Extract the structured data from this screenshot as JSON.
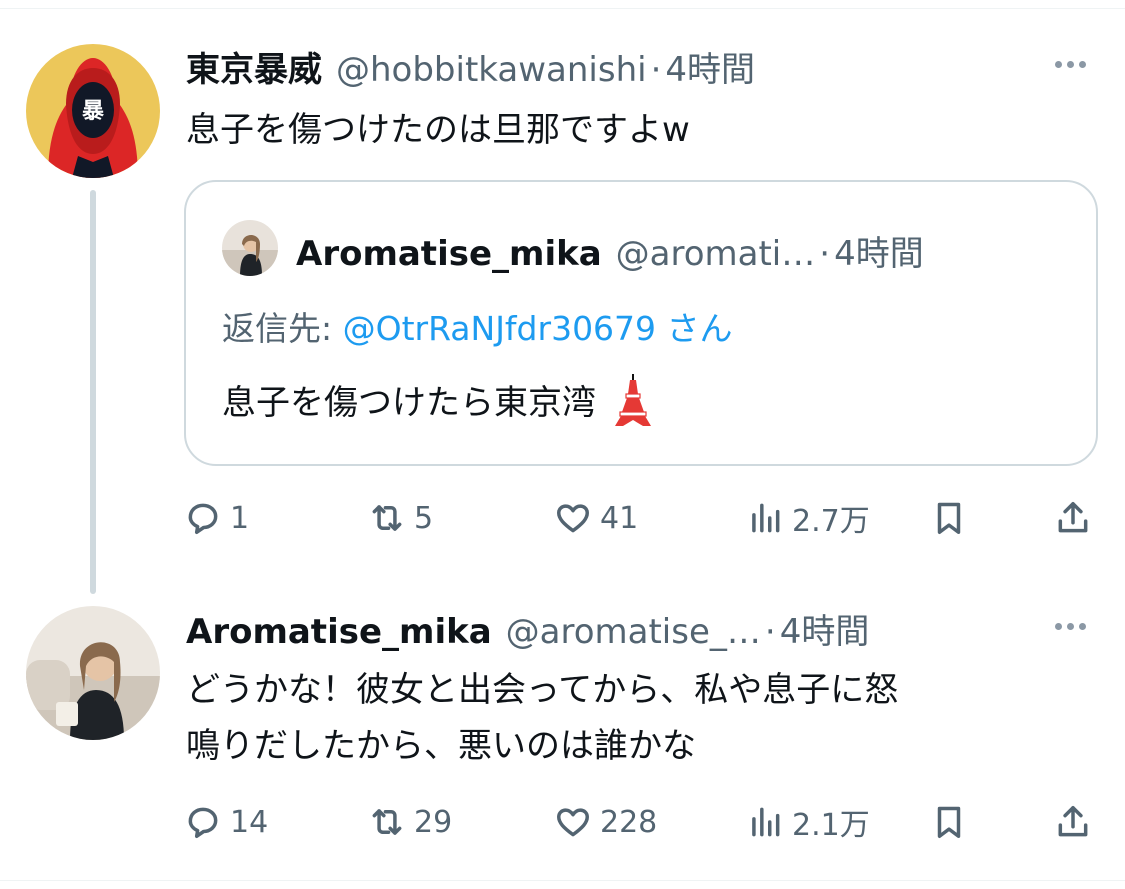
{
  "colors": {
    "text": "#0f1419",
    "secondary": "#536471",
    "link": "#1d9bf0",
    "border": "#cfd9de",
    "avatar1_bg": "#ecc75a",
    "hood": "#dc2626"
  },
  "tweets": [
    {
      "avatar_glyph": "暴",
      "name": "東京暴威",
      "handle": "@hobbitkawanishi",
      "separator": "·",
      "time": "4時間",
      "text": "息子を傷つけたのは旦那ですよw",
      "quote": {
        "name": "Aromatise_mika",
        "handle": "@aromati…",
        "separator": "·",
        "time": "4時間",
        "reply_label": "返信先: ",
        "reply_target": "@OtrRaNJfdr30679 さん",
        "text": "息子を傷つけたら東京湾",
        "emoji": "🗼"
      },
      "actions": {
        "replies": "1",
        "retweets": "5",
        "likes": "41",
        "views": "2.7万"
      }
    },
    {
      "name": "Aromatise_mika",
      "handle": "@aromatise_…",
      "separator": "·",
      "time": "4時間",
      "text_lines": [
        "どうかな！彼女と出会ってから、私や息子に怒",
        "鳴りだしたから、悪いのは誰かな"
      ],
      "actions": {
        "replies": "14",
        "retweets": "29",
        "likes": "228",
        "views": "2.1万"
      }
    }
  ]
}
